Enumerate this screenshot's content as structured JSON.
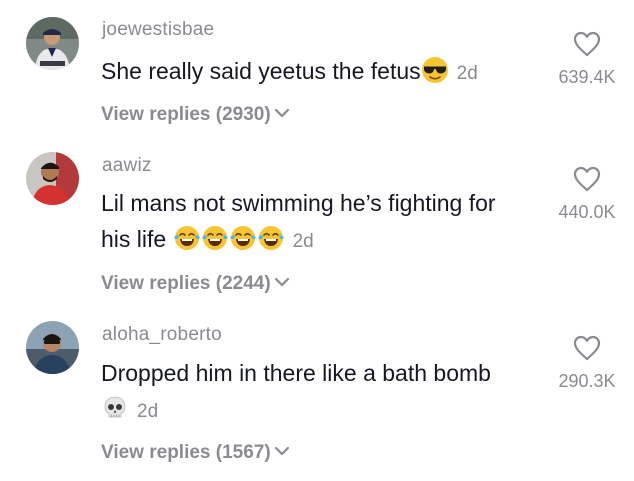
{
  "comments": [
    {
      "username": "joewestisbae",
      "text": "She really said yeetus the fetus",
      "emojis": [
        "smiling-face-with-sunglasses"
      ],
      "age": "2d",
      "likes": "639.4K",
      "replies": "View replies (2930)"
    },
    {
      "username": "aawiz",
      "text_line1": "Lil mans not swimming he’s fighting for",
      "text_line2": "his life",
      "emojis": [
        "face-with-tears-of-joy",
        "face-with-tears-of-joy",
        "face-with-tears-of-joy",
        "face-with-tears-of-joy"
      ],
      "age": "2d",
      "likes": "440.0K",
      "replies": "View replies (2244)"
    },
    {
      "username": "aloha_roberto",
      "text": "Dropped him in there like a bath bomb",
      "emojis": [
        "skull"
      ],
      "age": "2d",
      "likes": "290.3K",
      "replies": "View replies (1567)"
    }
  ],
  "colors": {
    "text": "#161823",
    "muted": "#8a8b91",
    "background": "#ffffff"
  }
}
